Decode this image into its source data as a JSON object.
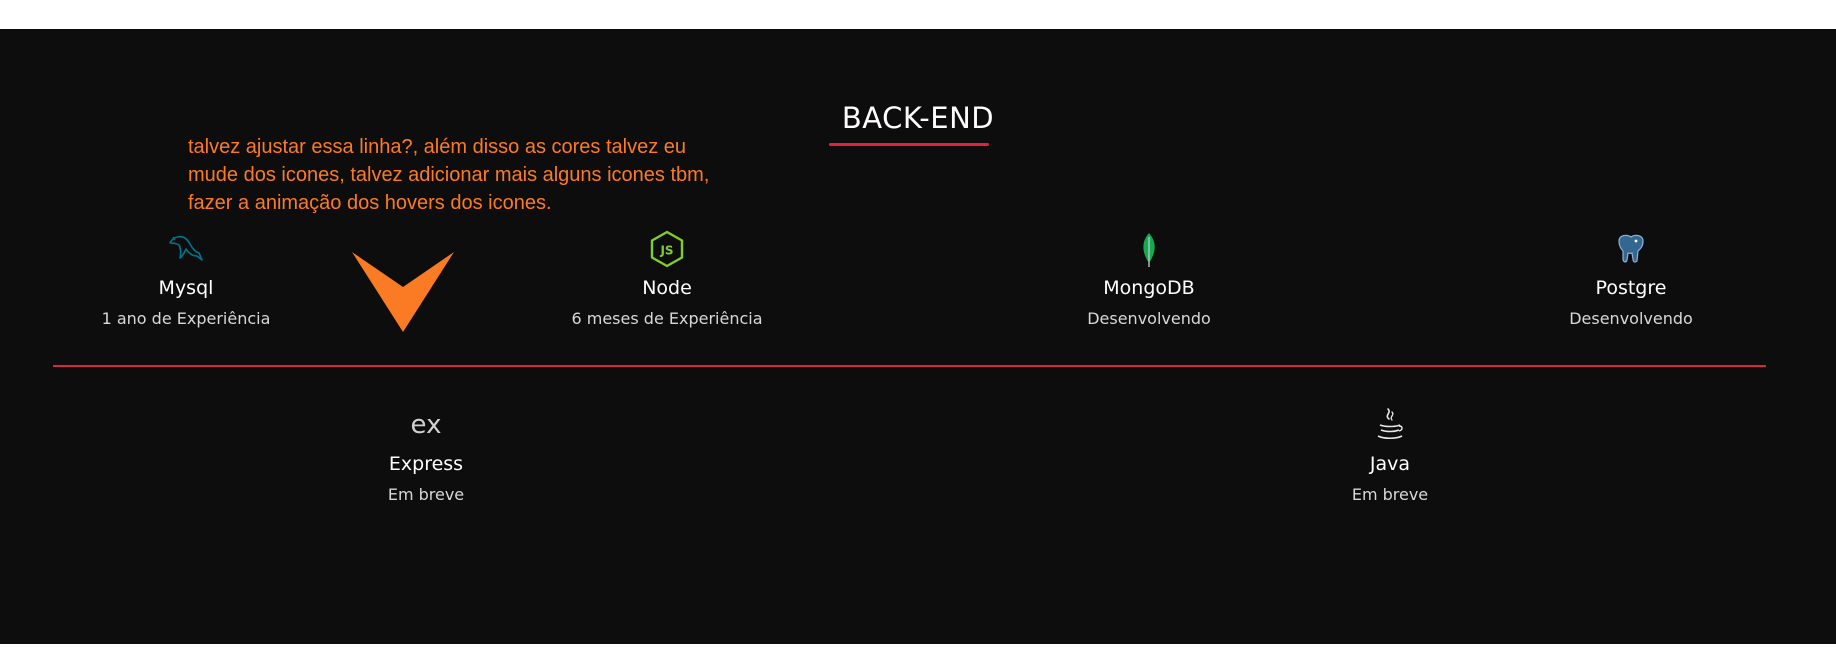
{
  "section": {
    "title": "BACK-END",
    "accent_color": "#e3213f",
    "background": "#0e0d0e"
  },
  "annotation": {
    "text": "talvez ajustar essa linha?, além disso as cores talvez eu mude dos icones, talvez adicionar mais alguns icones tbm, fazer a animação dos hovers dos icones.",
    "color": "#fb7b25",
    "arrow_icon": "arrow-down-icon"
  },
  "row1": [
    {
      "name": "Mysql",
      "sub": "1 ano de Experiência",
      "icon": "mysql-dolphin-icon",
      "icon_color": "#00758f"
    },
    {
      "name": "Node",
      "sub": "6 meses de Experiência",
      "icon": "nodejs-hexagon-icon",
      "icon_color": "#83cd29"
    },
    {
      "name": "MongoDB",
      "sub": "Desenvolvendo",
      "icon": "mongodb-leaf-icon",
      "icon_color": "#13aa52"
    },
    {
      "name": "Postgre",
      "sub": "Desenvolvendo",
      "icon": "postgresql-elephant-icon",
      "icon_color": "#336791"
    }
  ],
  "row2": [
    {
      "name": "Express",
      "sub": "Em breve",
      "icon": "express-icon",
      "icon_glyph": "ex",
      "icon_color": "#d0d0d0"
    },
    {
      "name": "Java",
      "sub": "Em breve",
      "icon": "java-cup-icon",
      "icon_color": "#e8e8e8"
    }
  ]
}
